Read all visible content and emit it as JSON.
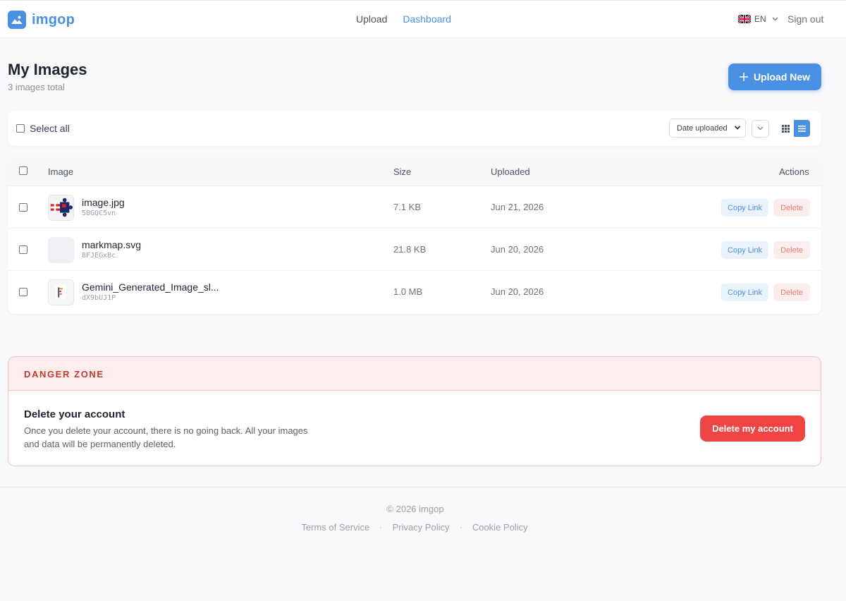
{
  "header": {
    "logo_text": "imgop",
    "nav": [
      {
        "label": "Upload",
        "active": false
      },
      {
        "label": "Dashboard",
        "active": true
      }
    ],
    "language": "EN",
    "signout_label": "Sign out"
  },
  "page": {
    "title": "My Images",
    "subtitle": "3 images total",
    "upload_label": "Upload New"
  },
  "toolbar": {
    "select_all_label": "Select all",
    "sort_value": "Date uploaded"
  },
  "table": {
    "headers": {
      "image": "Image",
      "size": "Size",
      "uploaded": "Uploaded",
      "actions": "Actions"
    },
    "rows": [
      {
        "name": "image.jpg",
        "id": "5BGQC5vn",
        "size": "7.1 KB",
        "date": "Jun 21, 2026",
        "copy": "Copy Link",
        "delete": "Delete"
      },
      {
        "name": "markmap.svg",
        "id": "BFJEGxBc",
        "size": "21.8 KB",
        "date": "Jun 20, 2026",
        "copy": "Copy Link",
        "delete": "Delete"
      },
      {
        "name": "Gemini_Generated_Image_sl...",
        "id": "dX9bUJ1P",
        "size": "1.0 MB",
        "date": "Jun 20, 2026",
        "copy": "Copy Link",
        "delete": "Delete"
      }
    ]
  },
  "danger": {
    "title": "DANGER ZONE",
    "heading": "Delete your account",
    "text": "Once you delete your account, there is no going back. All your images and data will be permanently deleted.",
    "button": "Delete my account"
  },
  "footer": {
    "copyright": "© 2026 imgop",
    "links": [
      "Terms of Service",
      "Privacy Policy",
      "Cookie Policy"
    ],
    "separator": "·"
  },
  "colors": {
    "accent": "#4a90e2",
    "danger": "#ef4444",
    "danger_title": "#c0392b"
  }
}
